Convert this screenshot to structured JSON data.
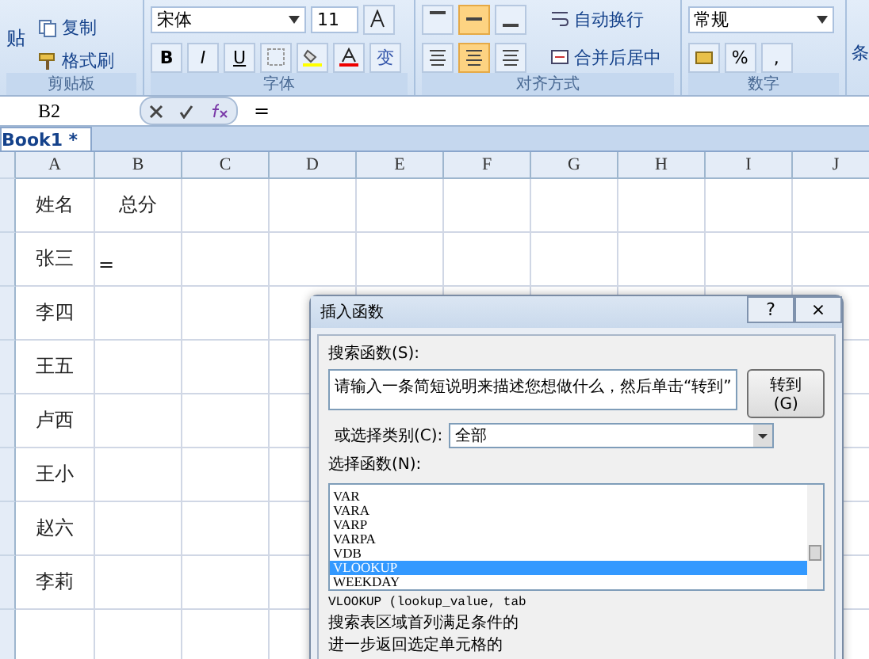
{
  "clipboard": {
    "paste": "贴",
    "copy": "复制",
    "format_painter": "格式刷",
    "label": "剪贴板"
  },
  "font": {
    "name": "宋体",
    "size": "11",
    "bold": "B",
    "italic": "I",
    "underline": "U",
    "phonetic": "变",
    "label": "字体"
  },
  "alignment": {
    "valign": [
      {
        "selected": false
      },
      {
        "selected": true
      },
      {
        "selected": false
      }
    ],
    "halign": [
      {
        "selected": false
      },
      {
        "selected": true
      },
      {
        "selected": false
      }
    ],
    "wrap": "自动换行",
    "merge": "合并后居中",
    "label": "对齐方式"
  },
  "number": {
    "format": "常规",
    "percent": "%",
    "comma": ",",
    "label": "数字"
  },
  "next_group": "条",
  "formula_bar": {
    "name_box": "B2",
    "formula": "="
  },
  "workbook_tab": "Book1 *",
  "columns": [
    "A",
    "B",
    "C",
    "D",
    "E",
    "F",
    "G",
    "H",
    "I",
    "J"
  ],
  "rows": [
    {
      "a": "姓名",
      "b": "总分"
    },
    {
      "a": "张三",
      "b": "="
    },
    {
      "a": "李四",
      "b": ""
    },
    {
      "a": "王五",
      "b": ""
    },
    {
      "a": "卢西",
      "b": ""
    },
    {
      "a": "王小",
      "b": ""
    },
    {
      "a": "赵六",
      "b": ""
    },
    {
      "a": "李莉",
      "b": ""
    },
    {
      "a": "",
      "b": ""
    }
  ],
  "dialog": {
    "title": "插入函数",
    "help": "?",
    "close": "×",
    "search_label": "搜索函数(S):",
    "search_value": "请输入一条简短说明来描述您想做什么，然后单击“转到”",
    "go": "转到(G)",
    "category_label": "或选择类别(C):",
    "category": "全部",
    "list_label": "选择函数(N):",
    "functions": [
      {
        "name": "VAR",
        "selected": false
      },
      {
        "name": "VARA",
        "selected": false
      },
      {
        "name": "VARP",
        "selected": false
      },
      {
        "name": "VARPA",
        "selected": false
      },
      {
        "name": "VDB",
        "selected": false
      },
      {
        "name": "VLOOKUP",
        "selected": true
      },
      {
        "name": "WEEKDAY",
        "selected": false
      }
    ],
    "signature": "VLOOKUP (lookup_value, tab",
    "description": [
      "搜索表区域首列满足条件的",
      "进一步返回选定单元格的"
    ]
  }
}
